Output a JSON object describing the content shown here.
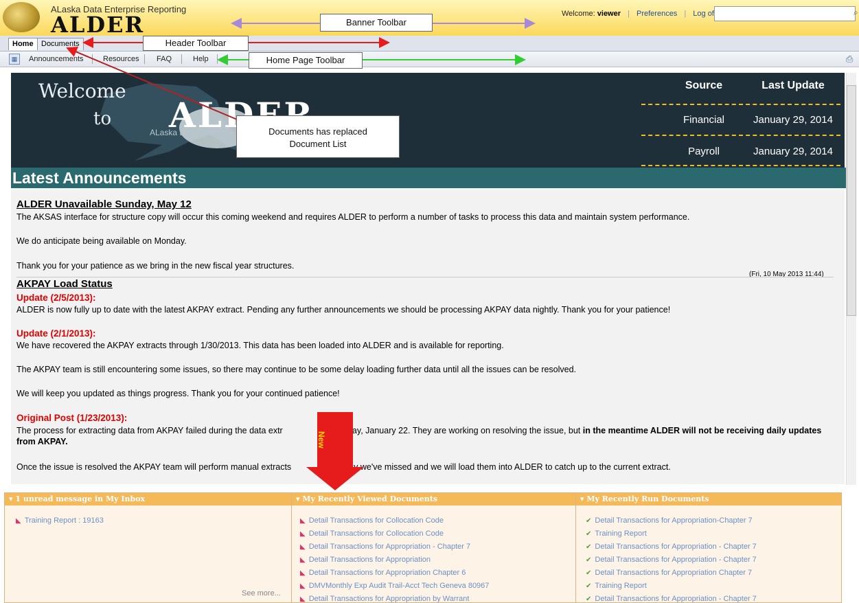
{
  "banner": {
    "app_subtitle": "ALaska Data Enterprise Reporting",
    "app_name": "ALDER",
    "welcome_label": "Welcome:",
    "username": "viewer",
    "preferences": "Preferences",
    "logoff": "Log off",
    "search_value": ""
  },
  "header_tabs": [
    "Home",
    "Documents"
  ],
  "home_toolbar": [
    "Announcements",
    "Resources",
    "FAQ",
    "Help"
  ],
  "welcome_panel": {
    "welcome": "Welcome",
    "to": "to",
    "alder": "ALDER",
    "alder_sub": "ALaska Data Enterprise Reporting",
    "table_headers": [
      "Source",
      "Last Update"
    ],
    "rows": [
      {
        "source": "Financial",
        "date": "January 29, 2014"
      },
      {
        "source": "Payroll",
        "date": "January 29, 2014"
      }
    ]
  },
  "latest_title": "Latest Announcements",
  "announcements": {
    "a1_title": "ALDER Unavailable Sunday, May 12",
    "a1_p1": "The AKSAS interface for structure copy will occur this coming weekend and requires ALDER to perform a number of tasks to process this data and maintain system performance.",
    "a1_p2": "We do anticipate being available on Monday.",
    "a1_p3": "Thank you for your patience as we bring in the new fiscal year structures.",
    "a1_date": "(Fri, 10 May 2013 11:44)",
    "a2_title": "AKPAY Load Status",
    "u1": "Update (2/5/2013):",
    "u1_text": "ALDER is now fully up to date with the latest AKPAY extract. Pending any further announcements we should be processing AKPAY data nightly. Thank you for your patience!",
    "u2": "Update (2/1/2013):",
    "u2_text": "We have recovered the AKPAY extracts through 1/30/2013. This data has been loaded into ALDER and is available for reporting.",
    "u2_p2": "The AKPAY team is still encountering some issues, so there may continue to be some delay loading further data until all the issues can be resolved.",
    "u2_p3": "We will keep you updated as things progress. Thank you for your continued patience!",
    "orig": "Original Post (1/23/2013):",
    "orig_text_a": "The process for extracting data from AKPAY failed during the data extr",
    "orig_text_b": "sday, January 22. They are working on resolving the issue, but ",
    "orig_bold": "in the meantime ALDER will not be receiving daily updates from AKPAY",
    "orig_end": ".",
    "orig_p2_a": "Once the issue is resolved the AKPAY team will perform manual extracts",
    "orig_p2_b": "ay we've missed and we will load them into ALDER to catch up to the current extract."
  },
  "portlets": {
    "inbox_title": "1 unread message in My Inbox",
    "inbox_items": [
      "Training Report : 19163"
    ],
    "see_more": "See more...",
    "viewed_title": "My Recently Viewed Documents",
    "viewed_items": [
      "Detail Transactions for Collocation Code",
      "Detail Transactions for Collocation Code",
      "Detail Transactions for Appropriation - Chapter 7",
      "Detail Transactions for Appropriation",
      "Detail Transactions for Appropriation Chapter 6",
      "DMVMonthly Exp Audit Trail-Acct Tech Geneva 80967",
      "Detail Transactions for Appropriation by Warrant"
    ],
    "run_title": "My Recently Run Documents",
    "run_items": [
      "Detail Transactions for Appropriation-Chapter 7",
      "Training Report",
      "Detail Transactions for Appropriation - Chapter 7",
      "Detail Transactions for Appropriation - Chapter 7",
      "Detail Transactions for Appropriation Chapter 7",
      "Training Report",
      "Detail Transactions for Appropriation - Chapter 7"
    ]
  },
  "annotations": {
    "banner_toolbar": "Banner Toolbar",
    "header_toolbar": "Header Toolbar",
    "home_page_toolbar": "Home Page Toolbar",
    "documents_note_1": "Documents has replaced",
    "documents_note_2": "Document List",
    "new_label": "New"
  },
  "colors": {
    "banner_yellow": "#fbd85a",
    "teal": "#2a6a6f",
    "panel_dark": "#1f2f3a",
    "dash_gold": "#f0c020",
    "alert_red": "#e00000",
    "arrow_red": "#e61c1c",
    "arrow_purple": "#a68ad8",
    "arrow_green": "#33cc33"
  }
}
